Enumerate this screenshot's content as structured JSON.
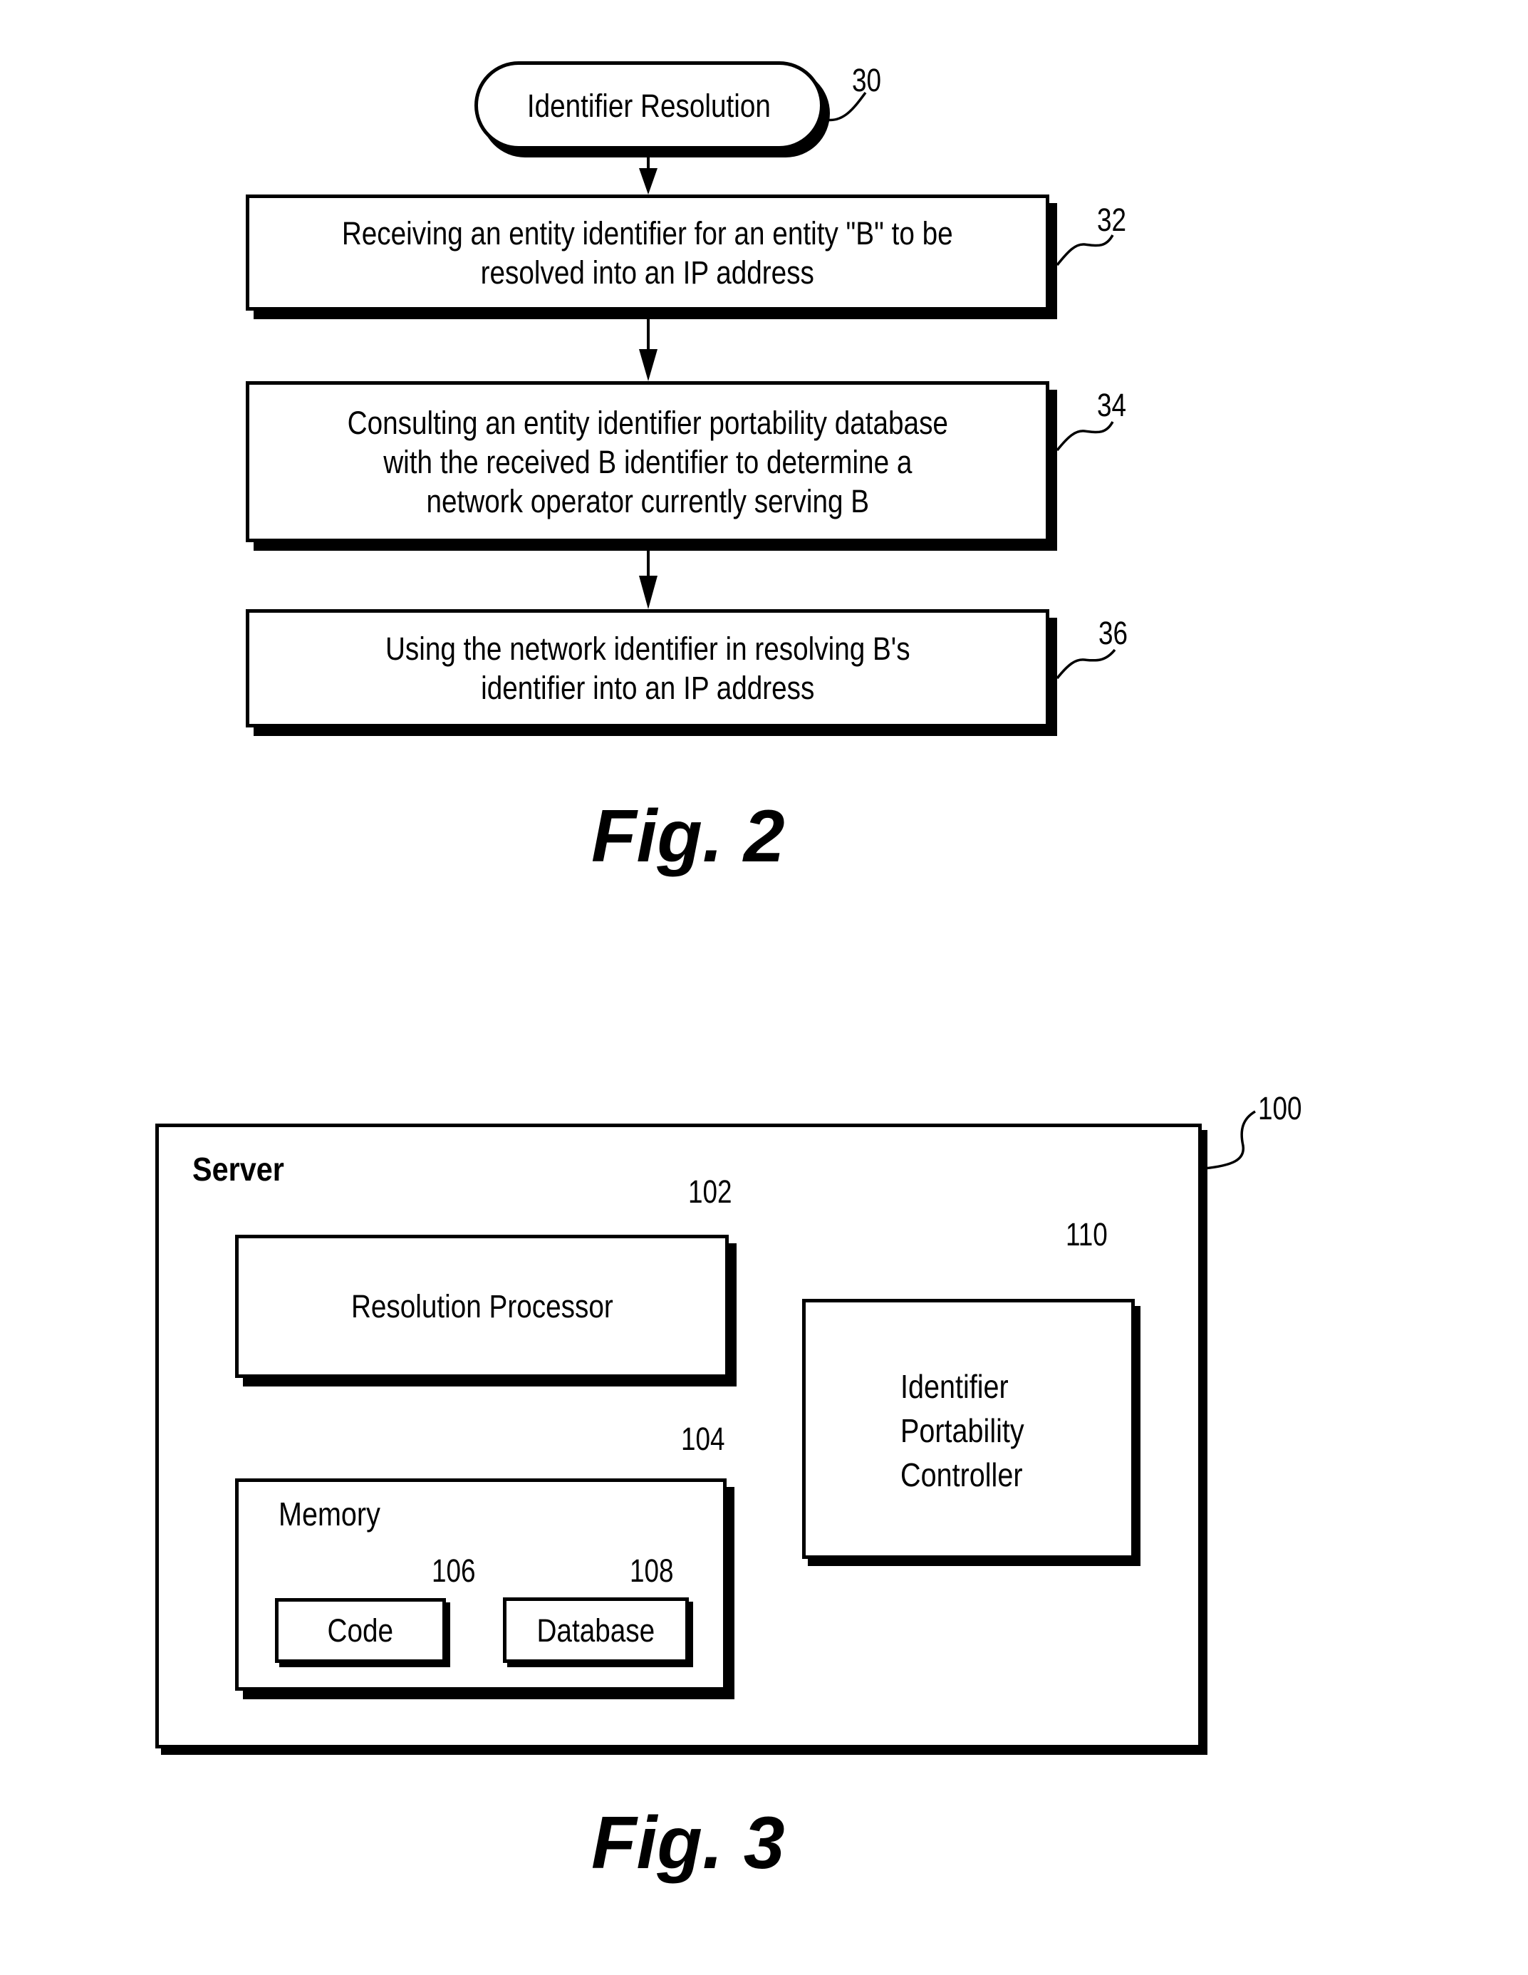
{
  "fig2": {
    "caption": "Fig. 2",
    "start": {
      "label": "Identifier Resolution",
      "ref": "30"
    },
    "steps": [
      {
        "ref": "32",
        "lines": [
          "Receiving an entity identifier for an entity \"B\" to be",
          "resolved into an IP address"
        ]
      },
      {
        "ref": "34",
        "lines": [
          "Consulting an entity identifier portability database",
          "with the received B identifier to determine a",
          "network operator currently serving B"
        ]
      },
      {
        "ref": "36",
        "lines": [
          "Using the network identifier in resolving B's",
          "identifier into an IP address"
        ]
      }
    ]
  },
  "fig3": {
    "caption": "Fig. 3",
    "server": {
      "label": "Server",
      "ref": "100"
    },
    "resolution_processor": {
      "label": "Resolution Processor",
      "ref": "102"
    },
    "memory": {
      "label": "Memory",
      "ref": "104"
    },
    "code": {
      "label": "Code",
      "ref": "106"
    },
    "database": {
      "label": "Database",
      "ref": "108"
    },
    "controller": {
      "lines": [
        "Identifier",
        "Portability",
        "Controller"
      ],
      "ref": "110"
    }
  }
}
